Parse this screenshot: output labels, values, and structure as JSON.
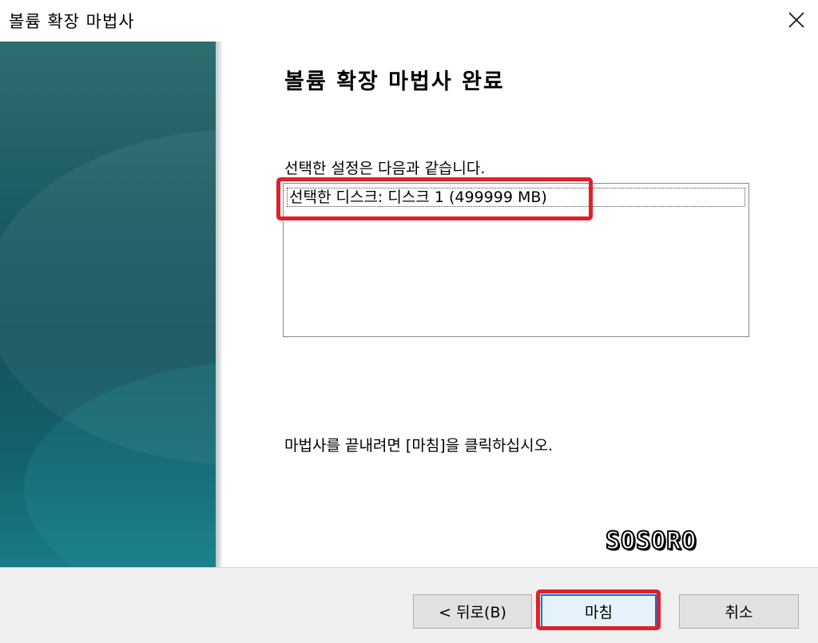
{
  "window": {
    "title": "볼륨 확장 마법사"
  },
  "page": {
    "heading": "볼륨 확장 마법사 완료",
    "summary_label": "선택한 설정은 다음과 같습니다.",
    "summary_items": [
      "선택한 디스크: 디스크 1 (499999 MB)"
    ],
    "finish_instruction": "마법사를 끝내려면 [마침]을 클릭하십시오."
  },
  "watermark": "SOSORO",
  "buttons": {
    "back": "< 뒤로(B)",
    "finish": "마침",
    "cancel": "취소"
  },
  "colors": {
    "highlight": "#e0202a",
    "side_panel": "#13525b",
    "focus_border": "#0078d7"
  }
}
